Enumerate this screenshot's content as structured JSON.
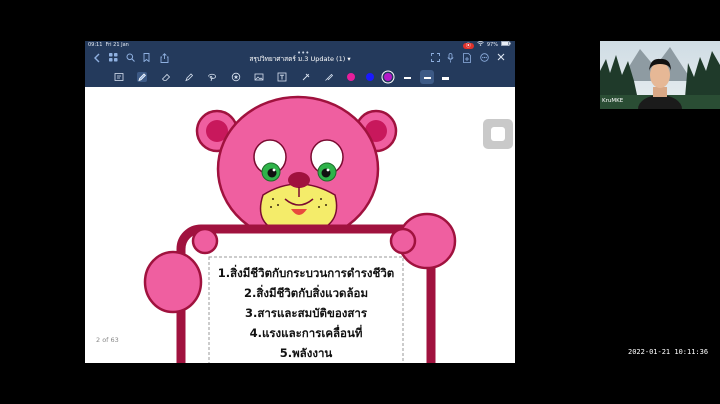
{
  "status_bar": {
    "time": "09:11",
    "date": "Fri 21 Jan",
    "record_label": "⦿",
    "battery": "97%"
  },
  "nav": {
    "title": "สรุปวิทยาศาสตร์ ม.3 Update (1)",
    "title_caret": "▾"
  },
  "toolbar": {
    "pen_colors": [
      "#e81e9c",
      "#1a1aff",
      "#b519c9"
    ]
  },
  "slide": {
    "items": [
      "1.สิ่งมีชีวิตกับกระบวนการดำรงชีวิต",
      "2.สิ่งมีชีวิตกับสิ่งแวดล้อม",
      "3.สารและสมบัติของสาร",
      "4.แรงและการเคลื่อนที่",
      "5.พลังงาน"
    ],
    "bear_color": "#ef5fa0",
    "board_border_color": "#a0123e"
  },
  "page_counter": "2 of 63",
  "webcam": {
    "name": "KruMKE"
  },
  "timestamp": "2022-01-21  10:11:36"
}
